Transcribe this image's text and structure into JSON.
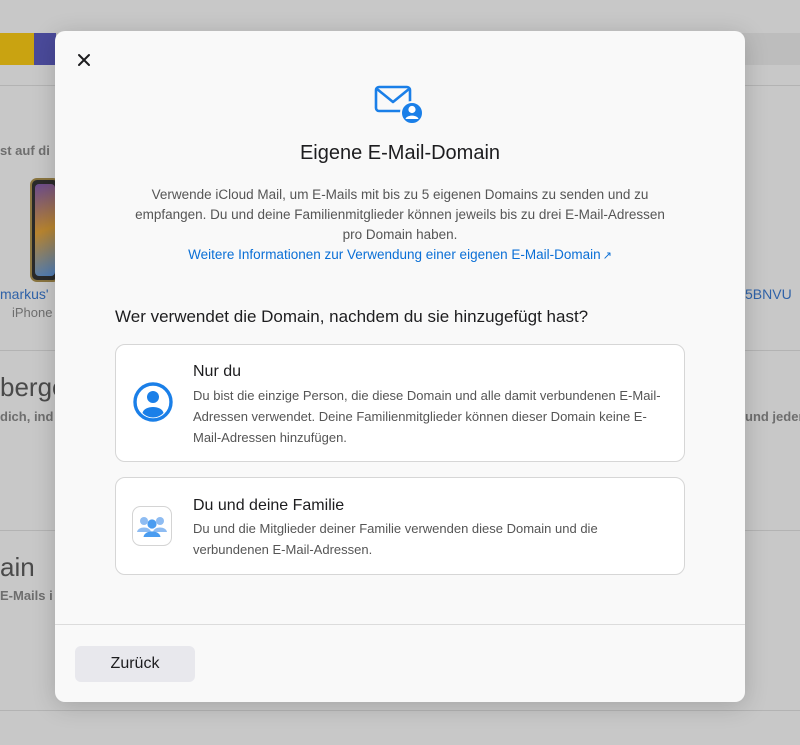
{
  "background": {
    "partial_texts": [
      "st auf di",
      "markus'",
      "iPhone",
      "5BNVU",
      "berge",
      "dich, ind",
      "und jeder",
      "ain",
      "E-Mails i"
    ]
  },
  "modal": {
    "close_icon": "close-icon",
    "header_icon": "mail-person-icon",
    "title": "Eigene E-Mail-Domain",
    "description": "Verwende iCloud Mail, um E-Mails mit bis zu 5 eigenen Domains zu senden und zu empfangen. Du und deine Familienmitglieder können jeweils bis zu drei E-Mail-Adressen pro Domain haben.",
    "learn_more_link": "Weitere Informationen zur Verwendung einer eigenen E-Mail-Domain",
    "learn_more_arrow": "↗",
    "question": "Wer verwendet die Domain, nachdem du sie hinzugefügt hast?",
    "options": [
      {
        "icon": "person-circle-icon",
        "title": "Nur du",
        "description": "Du bist die einzige Person, die diese Domain und alle damit verbundenen E-Mail-Adressen verwendet. Deine Familienmitglieder können dieser Domain keine E-Mail-Adressen hinzufügen."
      },
      {
        "icon": "family-icon",
        "title": "Du und deine Familie",
        "description": "Du und die Mitglieder deiner Familie verwenden diese Domain und die verbundenen E-Mail-Adressen."
      }
    ],
    "back_button": "Zurück"
  },
  "colors": {
    "accent": "#0a6fd6",
    "icon_blue": "#1a7fe8",
    "modal_bg": "#f9f9f9",
    "overlay_bg": "#c8c8c8"
  }
}
